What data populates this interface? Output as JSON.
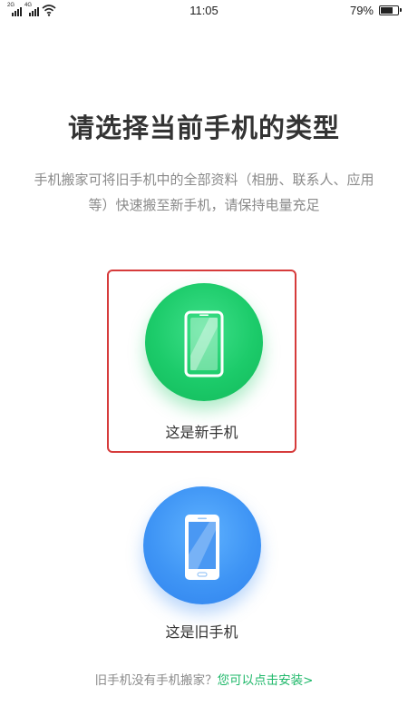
{
  "status_bar": {
    "sim1_tag": "2G",
    "sim2_tag": "4G",
    "time": "11:05",
    "battery_text": "79%",
    "battery_level": 0.79
  },
  "header": {
    "title": "请选择当前手机的类型",
    "subtitle": "手机搬家可将旧手机中的全部资料（相册、联系人、应用等）快速搬至新手机，请保持电量充足"
  },
  "options": {
    "new_phone": {
      "label": "这是新手机",
      "icon": "new-phone-icon",
      "color": "#1ccb6a",
      "selected": true
    },
    "old_phone": {
      "label": "这是旧手机",
      "icon": "old-phone-icon",
      "color": "#3f95f5",
      "selected": false
    }
  },
  "footer": {
    "prompt": "旧手机没有手机搬家？",
    "link": "您可以点击安装>"
  },
  "colors": {
    "accent_green": "#1fb86a",
    "selection_border": "#d63b3b",
    "title_text": "#333333",
    "muted_text": "#8a8a8a"
  }
}
